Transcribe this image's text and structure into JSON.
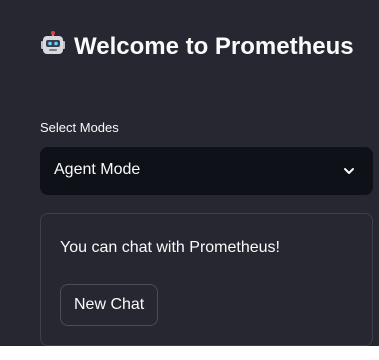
{
  "sidebar": {
    "title": "Welcome to Prometheus",
    "title_icon": "robot-face-icon",
    "select": {
      "label": "Select Modes",
      "value": "Agent Mode",
      "icon": "chevron-down-icon"
    },
    "card": {
      "text": "You can chat with Prometheus!",
      "button_label": "New Chat"
    }
  },
  "colors": {
    "sidebar_bg": "#262730",
    "select_bg": "#0e1117",
    "text": "#fafafa",
    "border": "#3e4049"
  }
}
